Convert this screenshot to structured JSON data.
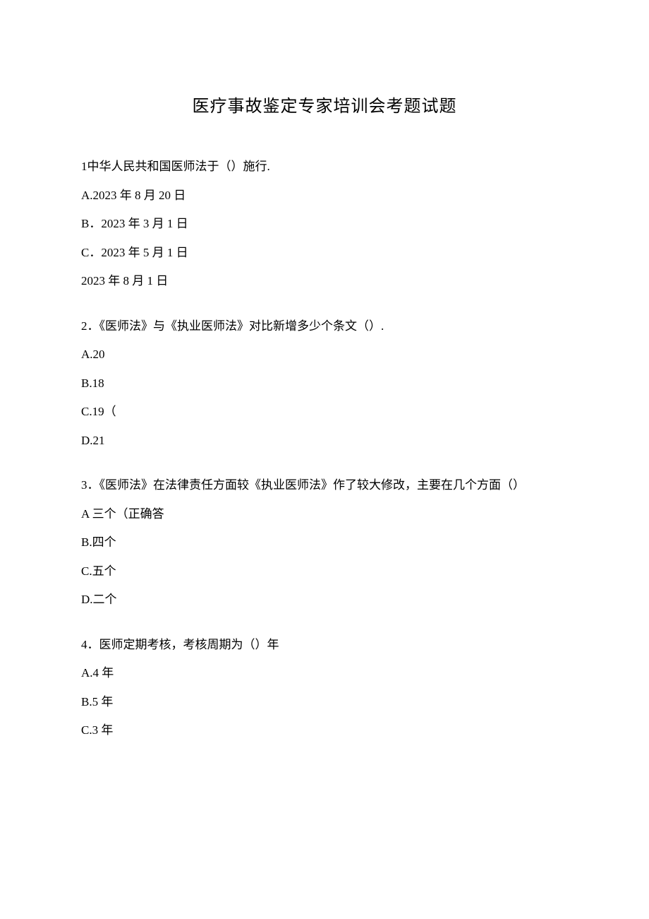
{
  "title": "医疗事故鉴定专家培训会考题试题",
  "questions": [
    {
      "num": "1",
      "text": "中华人民共和国医师法于（）施行.",
      "options": [
        "A.2023 年 8 月 20 日",
        "B．2023 年 3 月 1 日",
        "C．2023 年 5 月 1 日",
        "2023 年 8 月 1 日"
      ]
    },
    {
      "num": "2",
      "text": "．《医师法》与《执业医师法》对比新增多少个条文（）.",
      "options": [
        "A.20",
        "B.18",
        "C.19（",
        "D.21"
      ]
    },
    {
      "num": "3",
      "text": "．《医师法》在法律责任方面较《执业医师法》作了较大修改，主要在几个方面（）",
      "options": [
        "A 三个（正确答",
        "B.四个",
        "C.五个",
        "D.二个"
      ]
    },
    {
      "num": "4",
      "text": "．医师定期考核，考核周期为（）年",
      "options": [
        "A.4 年",
        "B.5 年",
        "C.3 年"
      ]
    }
  ]
}
